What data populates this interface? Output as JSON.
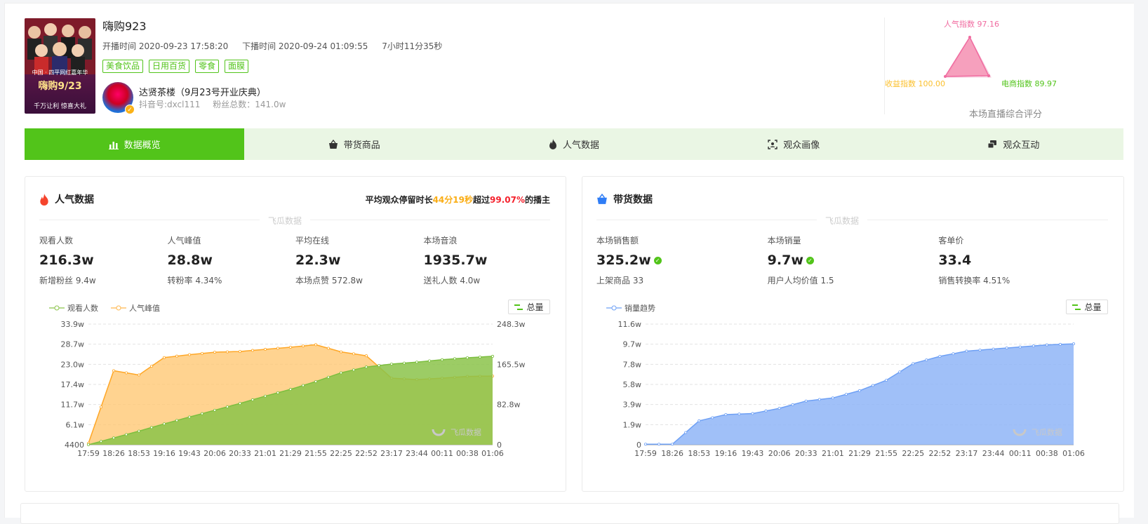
{
  "room": {
    "title": "嗨购923",
    "start_time": "开播时间 2020-09-23 17:58:20",
    "end_time": "下播时间 2020-09-24 01:09:55",
    "duration": "7小时11分35秒",
    "tags": [
      "美食饮品",
      "日用百货",
      "零食",
      "面膜"
    ],
    "cover": {
      "tiny": "中国 · 四平网红嘉年华",
      "title": "嗨购9/23",
      "sub": "千万让利  惊喜大礼"
    }
  },
  "anchor": {
    "name": "达贤茶楼（9月23号开业庆典）",
    "douyin_id": "抖音号:dxcl111",
    "fans": "粉丝总数：141.0w"
  },
  "radar": {
    "popularity": "人气指数 97.16",
    "revenue": "收益指数 100.00",
    "ecommerce": "电商指数 89.97",
    "footer": "本场直播综合评分",
    "colors": {
      "popularity": "#f06ba0",
      "revenue": "#fbc02d",
      "ecommerce": "#52c41a"
    }
  },
  "tabs": [
    {
      "label": "数据概览",
      "icon": "bar-chart-icon",
      "active": true
    },
    {
      "label": "带货商品",
      "icon": "basket-icon",
      "active": false
    },
    {
      "label": "人气数据",
      "icon": "fire-icon",
      "active": false
    },
    {
      "label": "观众画像",
      "icon": "scan-face-icon",
      "active": false
    },
    {
      "label": "观众互动",
      "icon": "chat-icon",
      "active": false
    }
  ],
  "popularity_panel": {
    "title": "人气数据",
    "note_prefix": "平均观众停留时长",
    "note_time": "44分19秒",
    "note_mid": "超过",
    "note_pct": "99.07%",
    "note_suffix": "的播主",
    "watermark": "飞瓜数据",
    "stats": [
      {
        "label": "观看人数",
        "value": "216.3w",
        "sub": "新增粉丝 9.4w"
      },
      {
        "label": "人气峰值",
        "value": "28.8w",
        "sub": "转粉率 4.34%"
      },
      {
        "label": "平均在线",
        "value": "22.3w",
        "sub": "本场点赞 572.8w"
      },
      {
        "label": "本场音浪",
        "value": "1935.7w",
        "sub": "送礼人数 4.0w"
      }
    ],
    "legend": [
      "观看人数",
      "人气峰值"
    ],
    "total_label": "总量",
    "chart_watermark": "飞瓜数据"
  },
  "sales_panel": {
    "title": "带货数据",
    "watermark": "飞瓜数据",
    "stats": [
      {
        "label": "本场销售额",
        "value": "325.2w",
        "verified": true,
        "sub": "上架商品 33"
      },
      {
        "label": "本场销量",
        "value": "9.7w",
        "verified": true,
        "sub": "用户人均价值 1.5"
      },
      {
        "label": "客单价",
        "value": "33.4",
        "verified": false,
        "sub": "销售转换率 4.51%"
      }
    ],
    "legend": [
      "销量趋势"
    ],
    "total_label": "总量",
    "chart_watermark": "飞瓜数据"
  },
  "chart_data": [
    {
      "type": "area",
      "categories": [
        "17:59",
        "18:26",
        "18:53",
        "19:16",
        "19:43",
        "20:06",
        "20:33",
        "21:01",
        "21:29",
        "21:55",
        "22:25",
        "22:52",
        "23:17",
        "23:44",
        "00:11",
        "00:38",
        "01:06"
      ],
      "y_left_ticks": [
        "4400",
        "6.1w",
        "11.7w",
        "17.4w",
        "23.0w",
        "28.7w",
        "33.9w"
      ],
      "y_right_ticks": [
        "0",
        "82.8w",
        "165.5w",
        "248.3w"
      ],
      "ylim_left": [
        0,
        33.9
      ],
      "ylim_right": [
        0,
        248.3
      ],
      "series": [
        {
          "name": "观看人数",
          "axis": "right",
          "color": "#8bc34a",
          "values": [
            0,
            14,
            28,
            43,
            57,
            71,
            85,
            100,
            114,
            130,
            148,
            160,
            166,
            170,
            175,
            179,
            182
          ]
        },
        {
          "name": "人气峰值",
          "axis": "left",
          "color": "#ffb74d",
          "values": [
            0.4,
            20.8,
            19.6,
            24.5,
            25.3,
            26.0,
            26.2,
            26.8,
            27.4,
            28.1,
            26.1,
            25.0,
            18.7,
            18.3,
            18.7,
            19.2,
            19.3
          ]
        }
      ],
      "grid": true
    },
    {
      "type": "area",
      "categories": [
        "17:59",
        "18:26",
        "18:53",
        "19:16",
        "19:43",
        "20:06",
        "20:33",
        "21:01",
        "21:29",
        "21:55",
        "22:25",
        "22:52",
        "23:17",
        "23:44",
        "00:11",
        "00:38",
        "01:06"
      ],
      "y_ticks": [
        "0",
        "1.9w",
        "3.9w",
        "5.8w",
        "7.8w",
        "9.7w",
        "11.6w"
      ],
      "ylim": [
        0,
        11.6
      ],
      "series": [
        {
          "name": "销量趋势",
          "color": "#6ea0f5",
          "values": [
            0.05,
            0.05,
            2.3,
            2.9,
            3.0,
            3.5,
            4.2,
            4.5,
            5.2,
            6.2,
            7.8,
            8.5,
            9.0,
            9.2,
            9.4,
            9.6,
            9.7
          ]
        }
      ],
      "grid": true
    }
  ]
}
